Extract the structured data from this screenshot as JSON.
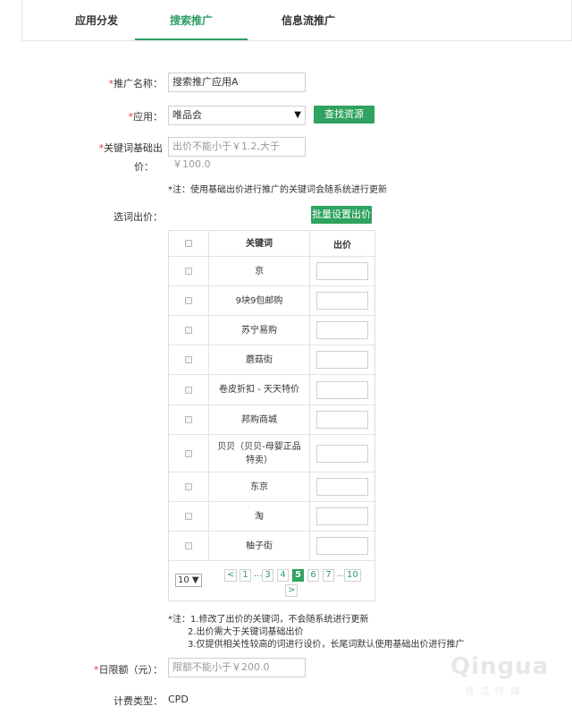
{
  "tabs": [
    {
      "label": "应用分发"
    },
    {
      "label": "搜索推广"
    },
    {
      "label": "信息流推广"
    }
  ],
  "form": {
    "required_mark": "*",
    "promo_name": {
      "label": "推广名称：",
      "value": "搜索推广应用A"
    },
    "app": {
      "label": "应用：",
      "value": "唯品会",
      "arrow": "▼",
      "button": "查找资源"
    },
    "base_bid": {
      "label_line1": "关键词基础出",
      "label_line2": "价：",
      "placeholder": "出价不能小于￥1.2,大于￥100.0"
    },
    "base_bid_note": "*注：使用基础出价进行推广的关键词会随系统进行更新",
    "word_bid": {
      "label": "选词出价：",
      "button": "批量设置出价"
    },
    "daily_limit": {
      "label": "日限额（元）：",
      "placeholder": "限额不能小于￥200.0"
    },
    "billing": {
      "label": "计费类型：",
      "value": "CPD"
    }
  },
  "table": {
    "headers": {
      "keyword": "关键词",
      "price": "出价"
    },
    "rows": [
      {
        "keyword": "京"
      },
      {
        "keyword": "9块9包邮购"
      },
      {
        "keyword": "苏宁易购"
      },
      {
        "keyword": "蘑菇街"
      },
      {
        "keyword": "卷皮折扣 - 天天特价"
      },
      {
        "keyword": "邦购商城"
      },
      {
        "keyword": "贝贝（贝贝-母婴正品特卖）"
      },
      {
        "keyword": "东京"
      },
      {
        "keyword": "淘"
      },
      {
        "keyword": "柚子街"
      }
    ]
  },
  "pagination": {
    "page_size": "10",
    "page_size_arrow": "▼",
    "prev": "<",
    "next": ">",
    "ellipsis": "...",
    "pages": [
      "1",
      "3",
      "4",
      "5",
      "6",
      "7",
      "10"
    ],
    "current": "5"
  },
  "notes": {
    "line1": "*注：1.修改了出价的关键词，不会随系统进行更新",
    "line2": "2.出价需大于关键词基础出价",
    "line3": "3.仅提供相关性较高的词进行设价，长尾词默认使用基础出价进行推广"
  },
  "watermark": {
    "text": "Qingua",
    "sub": "青瓜传媒"
  },
  "colors": {
    "accent": "#2fa35f",
    "required": "#e03a3a"
  }
}
